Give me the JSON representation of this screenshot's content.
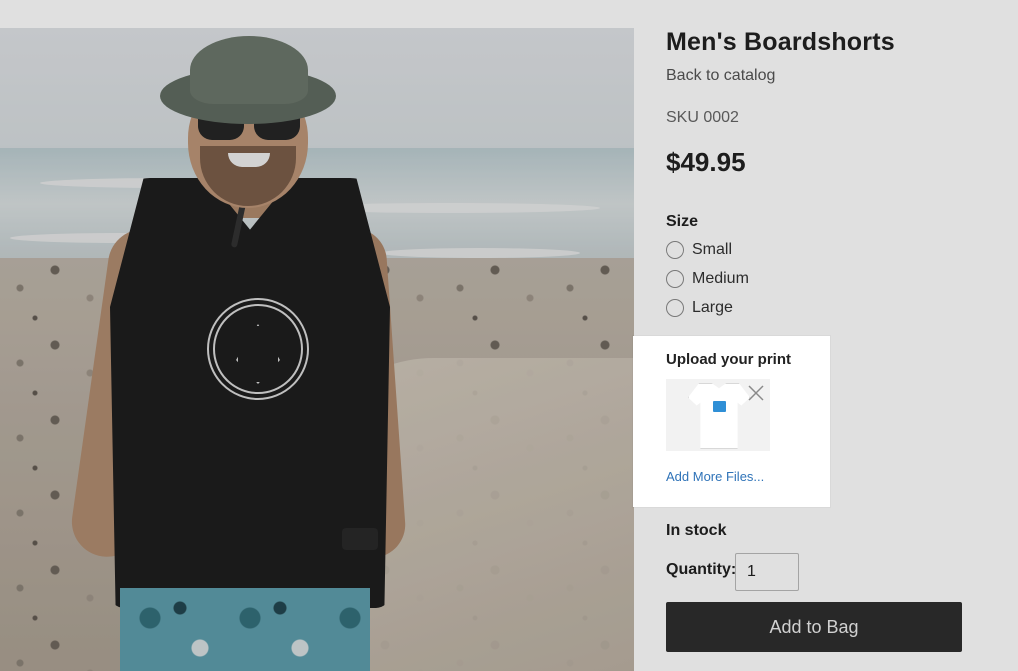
{
  "product": {
    "title": "Men's Boardshorts",
    "back_link": "Back to catalog",
    "sku": "SKU 0002",
    "price": "$49.95",
    "image_alt": "Man in bucket hat and black tank top on a pebble beach"
  },
  "size": {
    "label": "Size",
    "options": [
      {
        "label": "Small",
        "selected": false
      },
      {
        "label": "Medium",
        "selected": false
      },
      {
        "label": "Large",
        "selected": false
      }
    ]
  },
  "upload": {
    "title": "Upload your print",
    "file_thumbnail_icon": "tshirt-thumbnail",
    "remove_icon": "close-icon",
    "add_more_label": "Add More Files..."
  },
  "stock_status": "In stock",
  "quantity": {
    "label": "Quantity:",
    "value": "1"
  },
  "cart": {
    "add_label": "Add to Bag"
  },
  "colors": {
    "button_bg": "#2e2e2e",
    "link_blue": "#2f73b8",
    "text_dark": "#222222",
    "text_muted": "#555555"
  }
}
